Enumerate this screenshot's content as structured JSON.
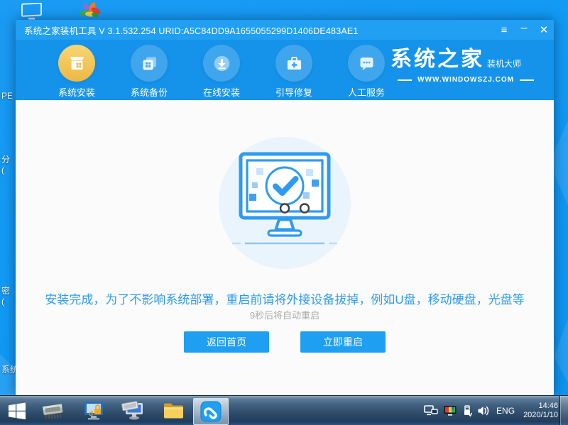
{
  "window": {
    "title": "系统之家装机工具 V 3.1.532.254 URID:A5C84DD9A1655055299D1406DE483AE1",
    "controls": {
      "menu": "≡",
      "minimize": "–",
      "close": "✕"
    }
  },
  "nav": {
    "items": [
      {
        "label": "系统安装",
        "icon": "package-icon",
        "active": true
      },
      {
        "label": "系统备份",
        "icon": "backup-icon",
        "active": false
      },
      {
        "label": "在线安装",
        "icon": "download-icon",
        "active": false
      },
      {
        "label": "引导修复",
        "icon": "toolbox-icon",
        "active": false
      },
      {
        "label": "人工服务",
        "icon": "chat-icon",
        "active": false
      }
    ],
    "logo": {
      "title": "系统之家",
      "subtitle": "装机大师",
      "url": "WWW.WINDOWSZJ.COM"
    }
  },
  "main": {
    "message": "安装完成，为了不影响系统部署，重启前请将外接设备拔掉，例如U盘，移动硬盘，光盘等",
    "countdown": "9秒后将自动重启",
    "buttons": [
      {
        "label": "返回首页"
      },
      {
        "label": "立即重启"
      }
    ]
  },
  "taskbar": {
    "tray": {
      "language": "ENG",
      "time": "14:46",
      "date": "2020/1/10"
    }
  },
  "desktop": {
    "partial_labels": [
      {
        "text": "PE"
      },
      {
        "text": "分\n("
      },
      {
        "text": "密\n("
      },
      {
        "text": "系统"
      }
    ]
  },
  "colors": {
    "titlebar": "#209ff3",
    "header": "#1593ea",
    "accent": "#1e9ff2",
    "active_gold": "#f0c254",
    "message_blue": "#2e9bf0",
    "desktop_blue": "#129af5"
  }
}
